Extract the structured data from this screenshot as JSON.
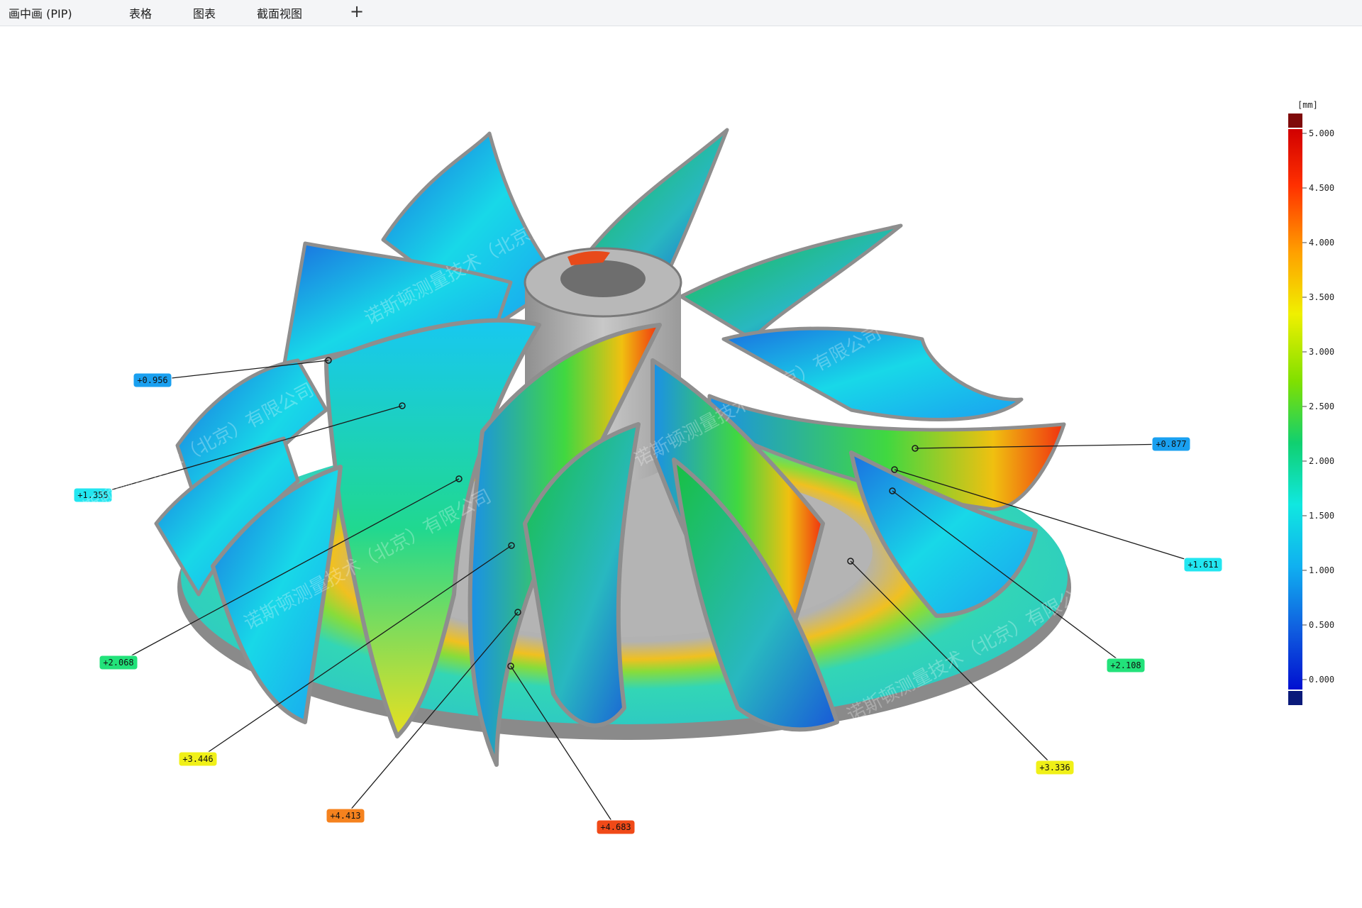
{
  "tabs": [
    {
      "label": "画中画 (PIP)"
    },
    {
      "label": "表格"
    },
    {
      "label": "图表"
    },
    {
      "label": "截面视图"
    }
  ],
  "add_tab_icon": "plus-icon",
  "watermark": "诺斯顿测量技术（北京）有限公司",
  "colorbar": {
    "unit": "[mm]",
    "ticks": [
      "5.000",
      "4.500",
      "4.000",
      "3.500",
      "3.000",
      "2.500",
      "2.000",
      "1.500",
      "1.000",
      "0.500",
      "0.000"
    ],
    "over_color": "#7f0a0a",
    "under_color": "#0a1a7a"
  },
  "annotations": [
    {
      "id": "a1",
      "value": "+0.956",
      "color": "#1aa0f0"
    },
    {
      "id": "a2",
      "value": "+1.355",
      "color": "#22e6f0"
    },
    {
      "id": "a3",
      "value": "+2.068",
      "color": "#22e27a"
    },
    {
      "id": "a4",
      "value": "+3.446",
      "color": "#f0f018"
    },
    {
      "id": "a5",
      "value": "+4.413",
      "color": "#f5821e"
    },
    {
      "id": "a6",
      "value": "+4.683",
      "color": "#f04a18"
    },
    {
      "id": "a7",
      "value": "+0.877",
      "color": "#1aa0f0"
    },
    {
      "id": "a8",
      "value": "+1.611",
      "color": "#22e6f0"
    },
    {
      "id": "a9",
      "value": "+2.108",
      "color": "#22e27a"
    },
    {
      "id": "a10",
      "value": "+3.336",
      "color": "#f0f018"
    }
  ]
}
